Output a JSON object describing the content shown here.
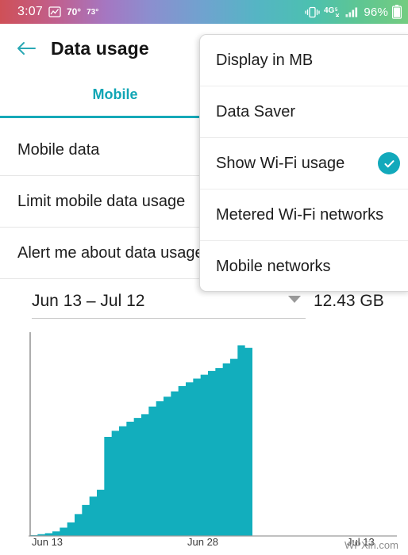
{
  "statusbar": {
    "time": "3:07",
    "weather_icon": "weather-graph-icon",
    "temp_high": "70°",
    "temp_low": "73°",
    "vibrate_icon": "vibrate-icon",
    "network_label": "4G",
    "network_sub": "LTE",
    "signal_icon": "signal-bars-icon",
    "battery_percent": "96%",
    "battery_icon": "battery-icon",
    "gradient": [
      "#cf5057",
      "#a577c2",
      "#6fa3cf",
      "#4cc0b0",
      "#74cc80"
    ]
  },
  "header": {
    "back_icon": "back-arrow-icon",
    "title": "Data usage"
  },
  "tabs": {
    "accent_color": "#16a9b8",
    "items": [
      {
        "label": "Mobile",
        "selected": true
      }
    ]
  },
  "settings_rows": [
    {
      "label": "Mobile data"
    },
    {
      "label": "Limit mobile data usage"
    },
    {
      "label": "Alert me about data usage"
    }
  ],
  "cycle": {
    "range": "Jun 13 – Jul 12",
    "caret_icon": "chevron-down-icon",
    "total": "12.43 GB"
  },
  "menu": {
    "items": [
      {
        "label": "Display in MB",
        "checked": false
      },
      {
        "label": "Data Saver",
        "checked": false
      },
      {
        "label": "Show Wi-Fi usage",
        "checked": true,
        "check_icon": "check-circle-icon"
      },
      {
        "label": "Metered Wi-Fi networks",
        "checked": false
      },
      {
        "label": "Mobile networks",
        "checked": false
      }
    ],
    "check_color": "#12a9bb"
  },
  "watermark": "WPXin.com",
  "chart_data": {
    "type": "area",
    "title": "",
    "xlabel": "",
    "ylabel": "",
    "series_color": "#12aebd",
    "grid": false,
    "legend": "none",
    "axis_ranges": {
      "x": [
        "Jun 13",
        "Jul 12"
      ],
      "y": [
        0,
        13.2
      ]
    },
    "xtick_labels": [
      "Jun 13",
      "Jun 28",
      "Jul 13"
    ],
    "xtick_positions": [
      0,
      15,
      30
    ],
    "units": "GB",
    "total_label": "12.43 GB",
    "x": [
      0,
      1,
      2,
      3,
      4,
      5,
      6,
      7,
      8,
      9,
      10,
      11,
      12,
      13,
      14,
      15,
      16,
      17,
      18,
      19,
      20,
      21,
      22,
      23,
      24,
      25,
      26,
      27,
      28,
      29
    ],
    "values": [
      0.05,
      0.12,
      0.18,
      0.3,
      0.55,
      0.9,
      1.45,
      2.05,
      2.6,
      3.05,
      6.55,
      6.95,
      7.25,
      7.55,
      7.8,
      8.05,
      8.55,
      8.9,
      9.2,
      9.55,
      9.9,
      10.15,
      10.4,
      10.65,
      10.9,
      11.1,
      11.4,
      11.7,
      12.6,
      12.43
    ]
  }
}
